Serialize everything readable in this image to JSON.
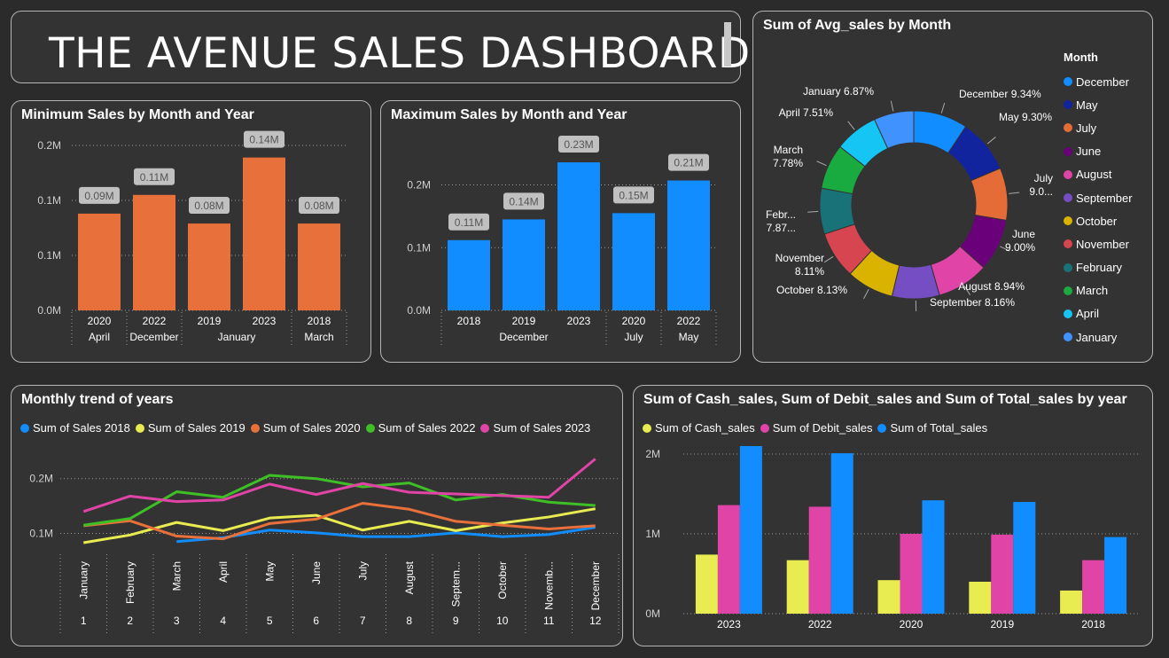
{
  "header": {
    "title": "THE AVENUE SALES DASHBOARD"
  },
  "min_chart": {
    "title": "Minimum Sales by Month and Year"
  },
  "max_chart": {
    "title": "Maximum Sales by Month and Year"
  },
  "donut_chart": {
    "title": "Sum of Avg_sales by Month",
    "legend_title": "Month"
  },
  "trend_chart": {
    "title": "Monthly trend of years"
  },
  "cash_chart": {
    "title": "Sum of Cash_sales, Sum of Debit_sales and Sum of Total_sales by year"
  },
  "chart_data": [
    {
      "type": "bar",
      "title": "Minimum Sales by Month and Year",
      "color": "#e8703a",
      "categories": [
        "2020",
        "2022",
        "2019",
        "2023",
        "2018"
      ],
      "groups": [
        {
          "label": "April",
          "span": 1
        },
        {
          "label": "December",
          "span": 1
        },
        {
          "label": "January",
          "span": 2
        },
        {
          "label": "March",
          "span": 1
        }
      ],
      "values": [
        0.088,
        0.105,
        0.079,
        0.139,
        0.079
      ],
      "data_labels": [
        "0.09M",
        "0.11M",
        "0.08M",
        "0.14M",
        "0.08M"
      ],
      "y_ticks": [
        0,
        0.05,
        0.1,
        0.15
      ],
      "y_tick_labels": [
        "0.0M",
        "0.1M",
        "0.1M",
        "0.2M"
      ],
      "ylim": [
        0,
        0.15
      ]
    },
    {
      "type": "bar",
      "title": "Maximum Sales by Month and Year",
      "color": "#118dff",
      "categories": [
        "2018",
        "2019",
        "2023",
        "2020",
        "2022"
      ],
      "groups": [
        {
          "label": "December",
          "span": 3
        },
        {
          "label": "July",
          "span": 1
        },
        {
          "label": "May",
          "span": 1
        }
      ],
      "values": [
        0.112,
        0.145,
        0.236,
        0.155,
        0.207
      ],
      "data_labels": [
        "0.11M",
        "0.14M",
        "0.23M",
        "0.15M",
        "0.21M"
      ],
      "y_ticks": [
        0,
        0.1,
        0.2
      ],
      "y_tick_labels": [
        "0.0M",
        "0.1M",
        "0.2M"
      ],
      "ylim": [
        0,
        0.27
      ]
    },
    {
      "type": "pie",
      "title": "Sum of Avg_sales by Month",
      "legend_title": "Month",
      "slices": [
        {
          "label": "December",
          "value": 9.34,
          "text": "December 9.34%",
          "color": "#118dff"
        },
        {
          "label": "May",
          "value": 9.3,
          "text": "May 9.30%",
          "color": "#12239e"
        },
        {
          "label": "July",
          "value": 9.0,
          "text": "July 9.0...",
          "color": "#e66c37"
        },
        {
          "label": "June",
          "value": 9.0,
          "text": "June 9.00%",
          "color": "#6b007b"
        },
        {
          "label": "August",
          "value": 8.94,
          "text": "August 8.94%",
          "color": "#e044a7"
        },
        {
          "label": "September",
          "value": 8.16,
          "text": "September 8.16%",
          "color": "#744ec2"
        },
        {
          "label": "October",
          "value": 8.13,
          "text": "October 8.13%",
          "color": "#d9b300"
        },
        {
          "label": "November",
          "value": 8.11,
          "text": "November 8.11%",
          "color": "#d64550"
        },
        {
          "label": "February",
          "value": 7.87,
          "text": "Febr... 7.87...",
          "color": "#197278"
        },
        {
          "label": "March",
          "value": 7.78,
          "text": "March 7.78%",
          "color": "#1aab40"
        },
        {
          "label": "April",
          "value": 7.51,
          "text": "April 7.51%",
          "color": "#15c6f4"
        },
        {
          "label": "January",
          "value": 6.87,
          "text": "January 6.87%",
          "color": "#4092ff"
        }
      ]
    },
    {
      "type": "line",
      "title": "Monthly trend of years",
      "x": [
        "January",
        "February",
        "March",
        "April",
        "May",
        "June",
        "July",
        "August",
        "Septem...",
        "October",
        "Novemb...",
        "December"
      ],
      "x_numbers": [
        "1",
        "2",
        "3",
        "4",
        "5",
        "6",
        "7",
        "8",
        "9",
        "10",
        "11",
        "12"
      ],
      "y_ticks": [
        0.1,
        0.2
      ],
      "y_tick_labels": [
        "0.1M",
        "0.2M"
      ],
      "ylim": [
        0.07,
        0.24
      ],
      "series": [
        {
          "name": "Sum of Sales 2018",
          "color": "#118dff",
          "values": [
            null,
            null,
            0.085,
            0.092,
            0.106,
            0.101,
            0.094,
            0.094,
            0.101,
            0.094,
            0.098,
            0.111
          ]
        },
        {
          "name": "Sum of Sales 2019",
          "color": "#e8ec50",
          "values": [
            0.083,
            0.097,
            0.12,
            0.105,
            0.128,
            0.133,
            0.106,
            0.122,
            0.105,
            0.119,
            0.13,
            0.145
          ]
        },
        {
          "name": "Sum of Sales 2020",
          "color": "#e8703a",
          "values": [
            0.114,
            0.123,
            0.095,
            0.09,
            0.118,
            0.126,
            0.155,
            0.144,
            0.122,
            0.115,
            0.108,
            0.114
          ]
        },
        {
          "name": "Sum of Sales 2022",
          "color": "#3fbf26",
          "values": [
            0.115,
            0.127,
            0.176,
            0.166,
            0.206,
            0.2,
            0.185,
            0.192,
            0.161,
            0.171,
            0.157,
            0.151
          ]
        },
        {
          "name": "Sum of Sales 2023",
          "color": "#e044a7",
          "values": [
            0.14,
            0.168,
            0.158,
            0.161,
            0.19,
            0.171,
            0.191,
            0.175,
            0.172,
            0.169,
            0.166,
            0.236
          ]
        }
      ]
    },
    {
      "type": "bar",
      "title": "Sum of Cash_sales, Sum of Debit_sales and Sum of Total_sales by year",
      "categories": [
        "2023",
        "2022",
        "2020",
        "2019",
        "2018"
      ],
      "y_ticks": [
        0,
        1,
        2
      ],
      "y_tick_labels": [
        "0M",
        "1M",
        "2M"
      ],
      "ylim": [
        0,
        2.3
      ],
      "series": [
        {
          "name": "Sum of Cash_sales",
          "color": "#e8ec50",
          "values": [
            0.74,
            0.67,
            0.42,
            0.4,
            0.29
          ]
        },
        {
          "name": "Sum of Debit_sales",
          "color": "#e044a7",
          "values": [
            1.36,
            1.34,
            1.0,
            0.99,
            0.67
          ]
        },
        {
          "name": "Sum of Total_sales",
          "color": "#118dff",
          "values": [
            2.1,
            2.01,
            1.42,
            1.4,
            0.96
          ]
        }
      ]
    }
  ]
}
